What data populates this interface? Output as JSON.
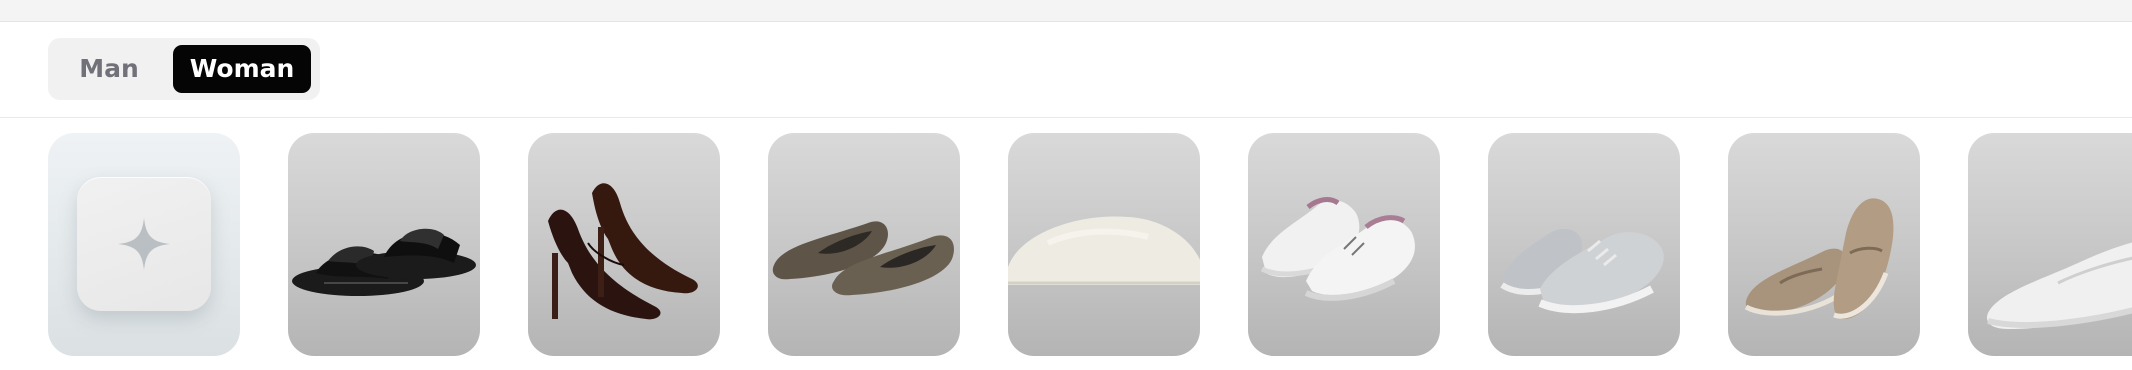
{
  "gender_toggle": {
    "options": [
      {
        "label": "Man",
        "selected": false
      },
      {
        "label": "Woman",
        "selected": true
      }
    ]
  },
  "colors": {
    "selected_bg": "#050505",
    "selected_text": "#ffffff",
    "unselected_text": "#71717a",
    "toggle_bg": "#f1f1f2"
  },
  "categories": [
    {
      "icon": "sparkle-icon",
      "kind": "ai-suggestions"
    },
    {
      "icon": "slide-sandals-image"
    },
    {
      "icon": "stiletto-pumps-image"
    },
    {
      "icon": "knit-ballet-flats-image"
    },
    {
      "icon": "fluffy-slippers-image"
    },
    {
      "icon": "knit-sneakers-image"
    },
    {
      "icon": "metallic-sneakers-image"
    },
    {
      "icon": "suede-loafers-image"
    },
    {
      "icon": "slip-on-sneakers-image"
    }
  ]
}
